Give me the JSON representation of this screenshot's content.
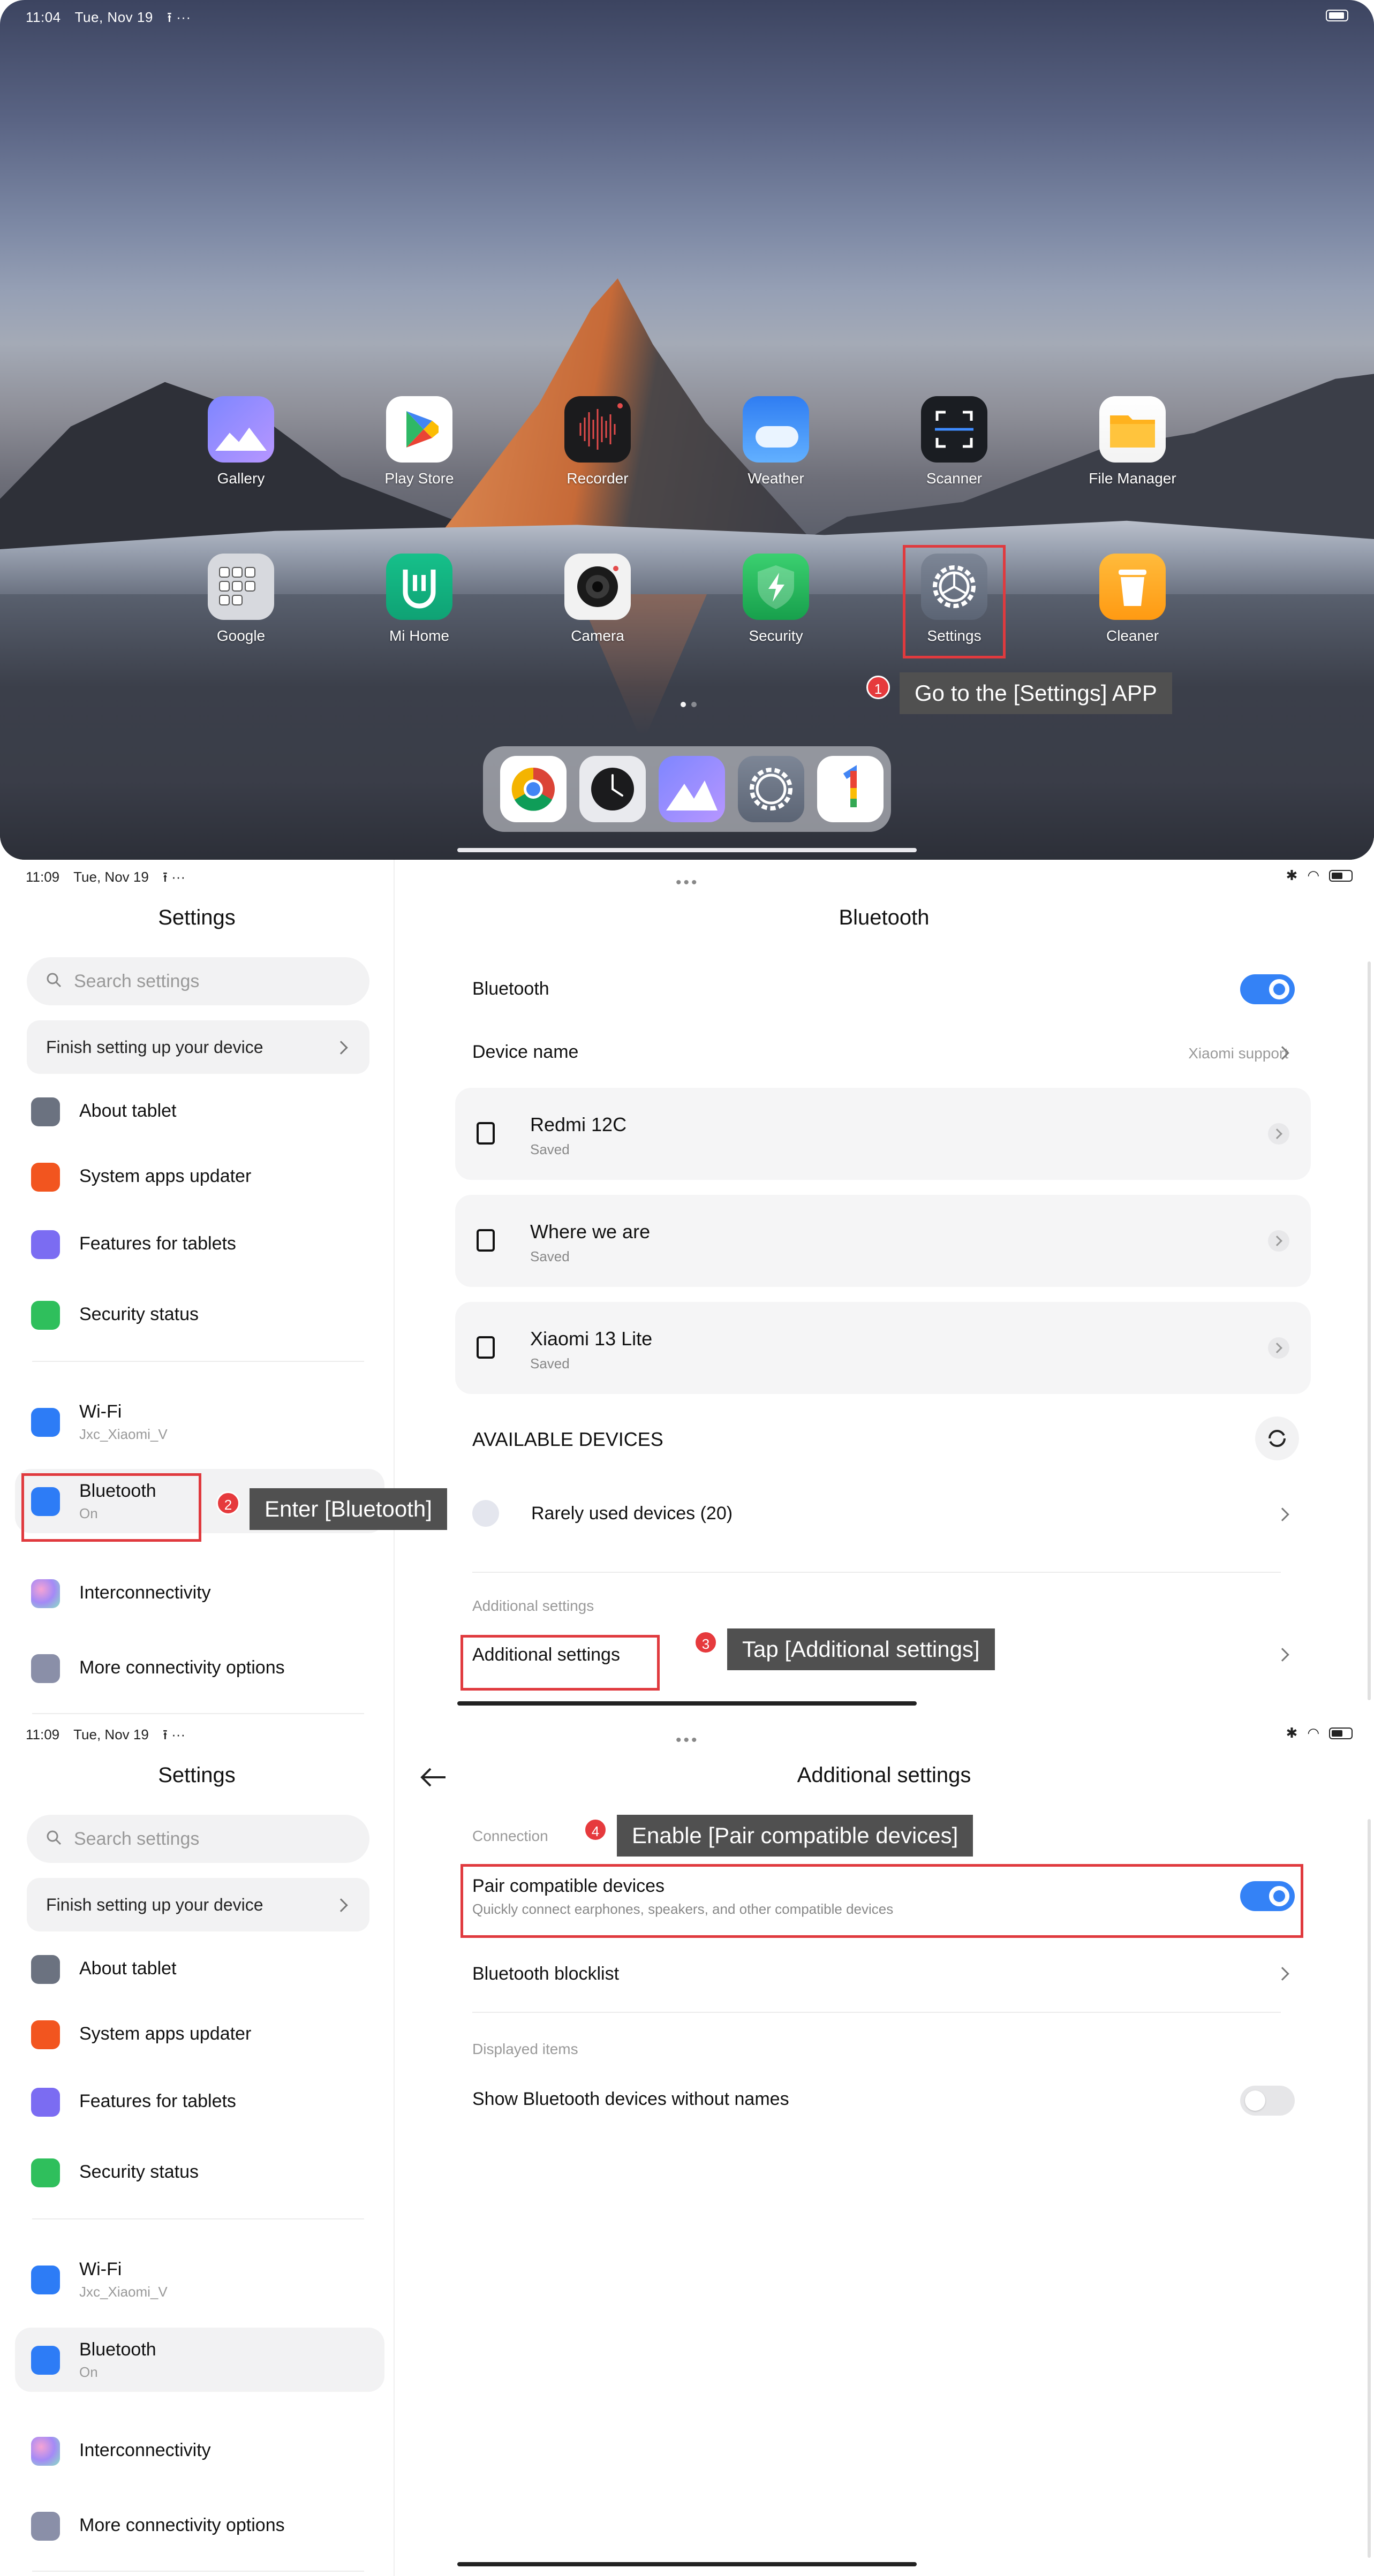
{
  "home": {
    "status_time": "11:04",
    "status_date": "Tue, Nov 19",
    "status_extra": "⭱  ···",
    "apps_row1": [
      {
        "label": "Gallery",
        "icon": "gallery-icon"
      },
      {
        "label": "Play Store",
        "icon": "play-store-icon"
      },
      {
        "label": "Recorder",
        "icon": "recorder-icon"
      },
      {
        "label": "Weather",
        "icon": "weather-icon"
      },
      {
        "label": "Scanner",
        "icon": "scanner-icon"
      },
      {
        "label": "File Manager",
        "icon": "file-manager-icon"
      }
    ],
    "apps_row2": [
      {
        "label": "Google",
        "icon": "google-folder-icon"
      },
      {
        "label": "Mi Home",
        "icon": "mi-home-icon"
      },
      {
        "label": "Camera",
        "icon": "camera-icon"
      },
      {
        "label": "Security",
        "icon": "security-icon"
      },
      {
        "label": "Settings",
        "icon": "settings-icon"
      },
      {
        "label": "Cleaner",
        "icon": "cleaner-icon"
      }
    ],
    "dock": [
      "chrome-icon",
      "clock-icon",
      "gallery-icon",
      "settings-icon",
      "google-one-icon"
    ]
  },
  "annotations": {
    "step1": {
      "num": "1",
      "text": "Go to the [Settings] APP"
    },
    "step2": {
      "num": "2",
      "text": "Enter [Bluetooth]"
    },
    "step3": {
      "num": "3",
      "text": "Tap [Additional settings]"
    },
    "step4": {
      "num": "4",
      "text": "Enable [Pair compatible devices]"
    },
    "color": "#e03a3e"
  },
  "status_settings": {
    "time": "11:09",
    "date": "Tue, Nov 19",
    "extra": "⭱  ···"
  },
  "settings_sidebar": {
    "title": "Settings",
    "search_placeholder": "Search settings",
    "finish_setup": "Finish setting up your device",
    "items_top": [
      {
        "label": "About tablet",
        "icon": "tablet-icon",
        "color": "#6b7280"
      },
      {
        "label": "System apps updater",
        "icon": "update-arrow-icon",
        "color": "#f2551f"
      },
      {
        "label": "Features for tablets",
        "icon": "grid-icon",
        "color": "#7b6cf2"
      },
      {
        "label": "Security status",
        "icon": "shield-check-icon",
        "color": "#2fbf5c"
      }
    ],
    "wifi": {
      "label": "Wi-Fi",
      "sub": "Jxc_Xiaomi_V",
      "icon": "wifi-icon",
      "color": "#2d7cf6"
    },
    "bluetooth": {
      "label": "Bluetooth",
      "sub": "On",
      "icon": "bluetooth-icon",
      "color": "#2d7cf6"
    },
    "interconnectivity": {
      "label": "Interconnectivity",
      "icon": "interconnectivity-icon"
    },
    "more_connectivity": {
      "label": "More connectivity options",
      "icon": "link-icon",
      "color": "#8a8fa8"
    }
  },
  "bluetooth_page": {
    "title": "Bluetooth",
    "bluetooth_label": "Bluetooth",
    "bluetooth_on": true,
    "device_name_label": "Device name",
    "device_name_value": "Xiaomi support",
    "saved_devices": [
      {
        "name": "Redmi 12C",
        "status": "Saved"
      },
      {
        "name": "Where we are",
        "status": "Saved"
      },
      {
        "name": "Xiaomi 13 Lite",
        "status": "Saved"
      }
    ],
    "available_header": "AVAILABLE DEVICES",
    "rarely_used": "Rarely used devices (20)",
    "additional_header": "Additional settings",
    "additional_item": "Additional settings"
  },
  "additional_page": {
    "title": "Additional settings",
    "connection_header": "Connection",
    "pair_title": "Pair compatible devices",
    "pair_sub": "Quickly connect earphones, speakers, and other compatible devices",
    "pair_on": true,
    "blocklist": "Bluetooth blocklist",
    "displayed_header": "Displayed items",
    "show_nameless": "Show Bluetooth devices without names",
    "show_nameless_on": false
  }
}
